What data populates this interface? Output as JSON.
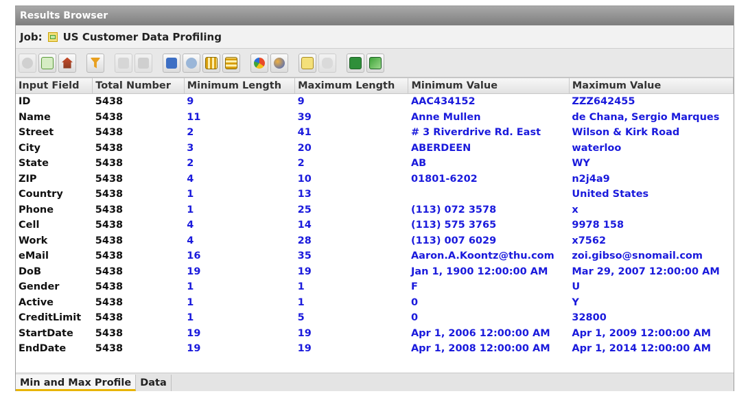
{
  "window": {
    "title": "Results Browser"
  },
  "job": {
    "label": "Job:",
    "name": "US Customer Data Profiling"
  },
  "toolbar": {
    "icons": [
      "stop-icon",
      "refresh-icon",
      "home-icon",
      "filter-icon",
      "copy-icon",
      "paste-icon",
      "export-icon",
      "scissors-icon",
      "columns-icon",
      "rows-icon",
      "pie-chart-icon",
      "globe-icon",
      "report-icon",
      "cylinder-icon",
      "excel-icon",
      "excel-export-icon"
    ]
  },
  "table": {
    "columns": [
      "Input Field",
      "Total Number",
      "Minimum Length",
      "Maximum Length",
      "Minimum Value",
      "Maximum Value"
    ],
    "rows": [
      [
        "ID",
        "5438",
        "9",
        "9",
        "AAC434152",
        "ZZZ642455"
      ],
      [
        "Name",
        "5438",
        "11",
        "39",
        " Anne Mullen",
        "de Chana, Sergio Marques"
      ],
      [
        "Street",
        "5438",
        "2",
        "41",
        "# 3 Riverdrive Rd. East",
        "Wilson & Kirk Road"
      ],
      [
        "City",
        "5438",
        "3",
        "20",
        "ABERDEEN",
        "waterloo"
      ],
      [
        "State",
        "5438",
        "2",
        "2",
        "AB",
        "WY"
      ],
      [
        "ZIP",
        "5438",
        "4",
        "10",
        "01801-6202",
        "n2j4a9"
      ],
      [
        "Country",
        "5438",
        "1",
        "13",
        "",
        "United States"
      ],
      [
        "Phone",
        "5438",
        "1",
        "25",
        "(113) 072 3578",
        "x"
      ],
      [
        "Cell",
        "5438",
        "4",
        "14",
        "(113) 575 3765",
        "9978 158"
      ],
      [
        "Work",
        "5438",
        "4",
        "28",
        "(113) 007 6029",
        "x7562"
      ],
      [
        "eMail",
        "5438",
        "16",
        "35",
        "Aaron.A.Koontz@thu.com",
        "zoi.gibso@snomail.com"
      ],
      [
        "DoB",
        "5438",
        "19",
        "19",
        "Jan 1, 1900 12:00:00 AM",
        "Mar 29, 2007 12:00:00 AM"
      ],
      [
        "Gender",
        "5438",
        "1",
        "1",
        "F",
        "U"
      ],
      [
        "Active",
        "5438",
        "1",
        "1",
        "0",
        "Y"
      ],
      [
        "CreditLimit",
        "5438",
        "1",
        "5",
        "0",
        "32800"
      ],
      [
        "StartDate",
        "5438",
        "19",
        "19",
        "Apr 1, 2006 12:00:00 AM",
        "Apr 1, 2009 12:00:00 AM"
      ],
      [
        "EndDate",
        "5438",
        "19",
        "19",
        "Apr 1, 2008 12:00:00 AM",
        "Apr 1, 2014 12:00:00 AM"
      ]
    ]
  },
  "tabs": [
    {
      "label": "Min and Max Profile",
      "active": true
    },
    {
      "label": "Data",
      "active": false
    }
  ],
  "colors": {
    "value_text": "#1a1adc",
    "tab_accent": "#e8b400"
  }
}
